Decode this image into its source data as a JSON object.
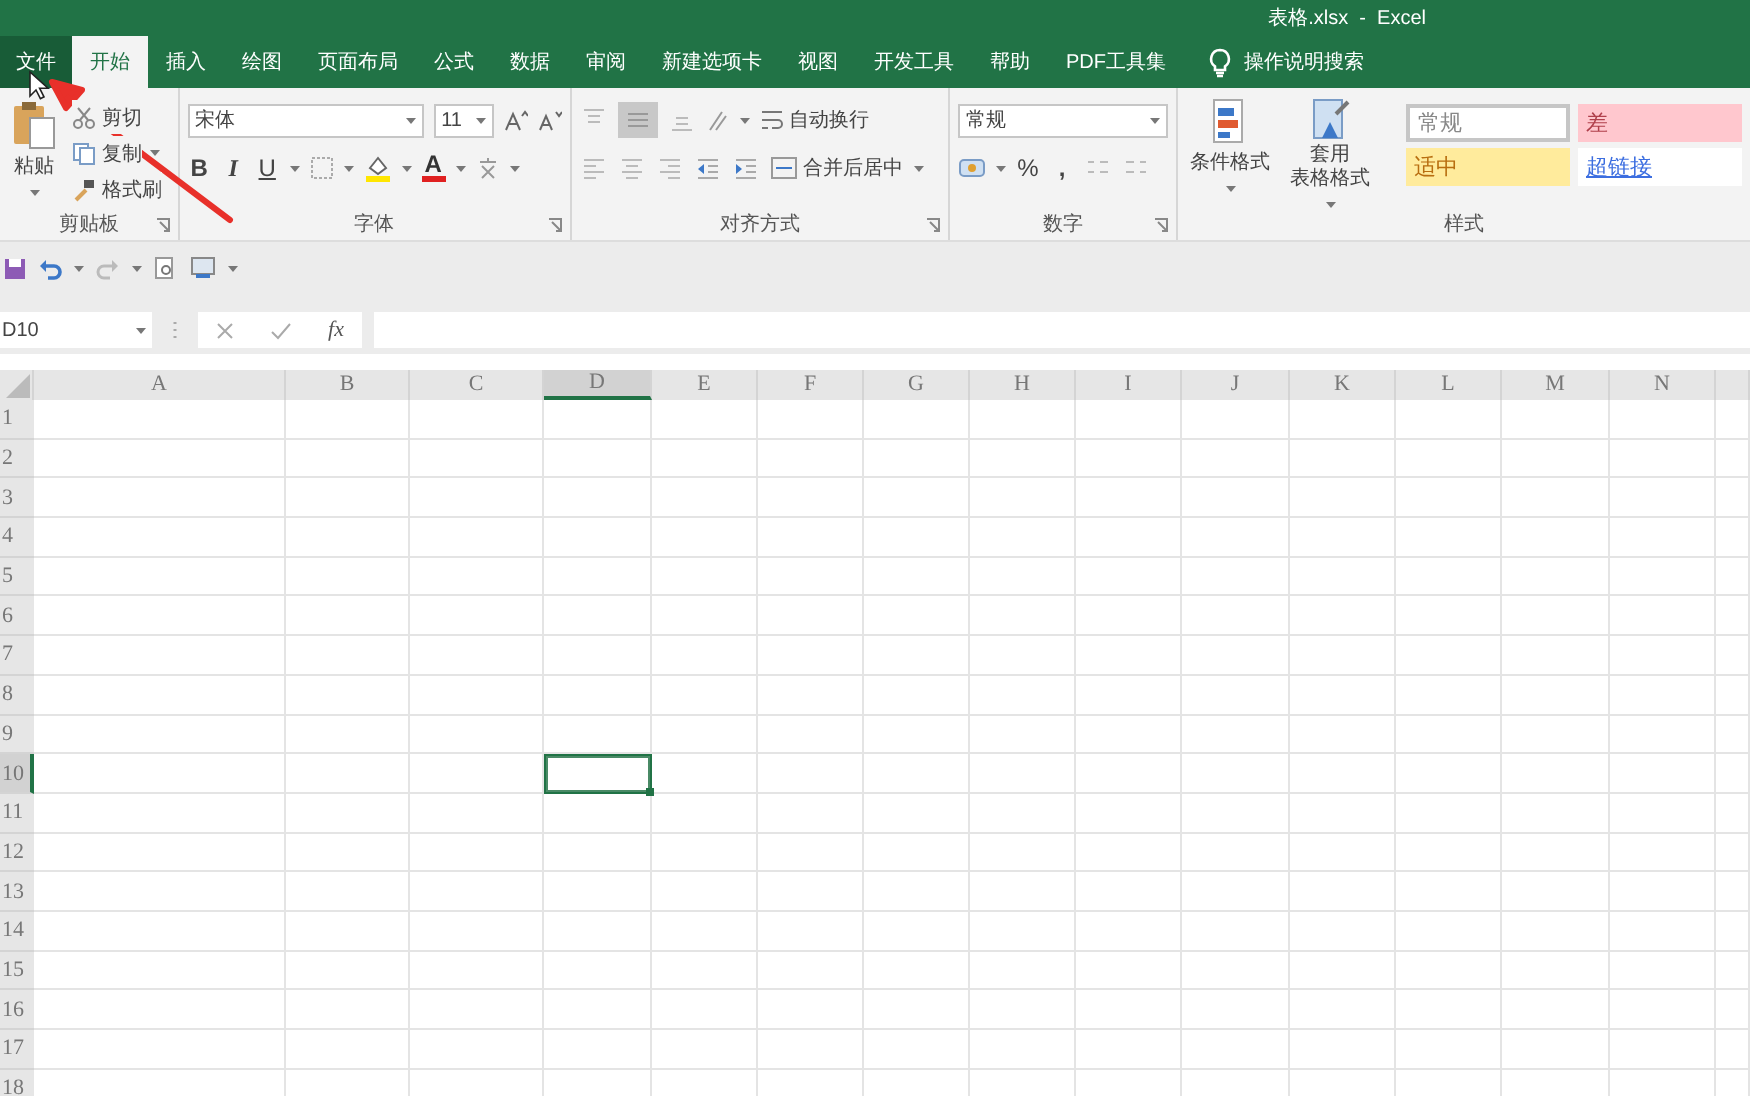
{
  "window": {
    "title": "表格.xlsx  -  Excel"
  },
  "tabs": [
    {
      "label": "文件",
      "kind": "file",
      "selected": false
    },
    {
      "label": "开始",
      "kind": "tab",
      "selected": true
    },
    {
      "label": "插入",
      "kind": "tab",
      "selected": false
    },
    {
      "label": "绘图",
      "kind": "tab",
      "selected": false
    },
    {
      "label": "页面布局",
      "kind": "tab",
      "selected": false
    },
    {
      "label": "公式",
      "kind": "tab",
      "selected": false
    },
    {
      "label": "数据",
      "kind": "tab",
      "selected": false
    },
    {
      "label": "审阅",
      "kind": "tab",
      "selected": false
    },
    {
      "label": "新建选项卡",
      "kind": "tab",
      "selected": false
    },
    {
      "label": "视图",
      "kind": "tab",
      "selected": false
    },
    {
      "label": "开发工具",
      "kind": "tab",
      "selected": false
    },
    {
      "label": "帮助",
      "kind": "tab",
      "selected": false
    },
    {
      "label": "PDF工具集",
      "kind": "tab",
      "selected": false
    }
  ],
  "tell_me": {
    "placeholder": "操作说明搜索"
  },
  "ribbon": {
    "clipboard": {
      "paste": "粘贴",
      "cut": "剪切",
      "copy": "复制",
      "format_painter": "格式刷",
      "label": "剪贴板"
    },
    "font": {
      "font_name": "宋体",
      "font_size": "11",
      "bold": "B",
      "italic": "I",
      "underline": "U",
      "font_color": "A",
      "label": "字体"
    },
    "alignment": {
      "wrap_text": "自动换行",
      "merge_center": "合并后居中",
      "label": "对齐方式"
    },
    "number": {
      "format": "常规",
      "percent": "%",
      "comma": ",",
      "label": "数字"
    },
    "styles": {
      "conditional_formatting": "条件格式",
      "format_as_table": [
        "套用",
        "表格格式"
      ],
      "label": "样式",
      "gallery": [
        {
          "label": "常规",
          "kind": "normal"
        },
        {
          "label": "差",
          "kind": "bad"
        },
        {
          "label": "适中",
          "kind": "neutral"
        },
        {
          "label": "超链接",
          "kind": "hyperlink"
        }
      ]
    }
  },
  "formula_bar": {
    "name_box": "D10",
    "fx": "fx"
  },
  "columns": [
    {
      "label": "A",
      "selected": false
    },
    {
      "label": "B",
      "selected": false
    },
    {
      "label": "C",
      "selected": false
    },
    {
      "label": "D",
      "selected": true
    },
    {
      "label": "E",
      "selected": false
    },
    {
      "label": "F",
      "selected": false
    },
    {
      "label": "G",
      "selected": false
    },
    {
      "label": "H",
      "selected": false
    },
    {
      "label": "I",
      "selected": false
    },
    {
      "label": "J",
      "selected": false
    },
    {
      "label": "K",
      "selected": false
    },
    {
      "label": "L",
      "selected": false
    },
    {
      "label": "M",
      "selected": false
    },
    {
      "label": "N",
      "selected": false
    }
  ],
  "rows": [
    {
      "label": "1",
      "selected": false
    },
    {
      "label": "2",
      "selected": false
    },
    {
      "label": "3",
      "selected": false
    },
    {
      "label": "4",
      "selected": false
    },
    {
      "label": "5",
      "selected": false
    },
    {
      "label": "6",
      "selected": false
    },
    {
      "label": "7",
      "selected": false
    },
    {
      "label": "8",
      "selected": false
    },
    {
      "label": "9",
      "selected": false
    },
    {
      "label": "10",
      "selected": true
    },
    {
      "label": "11",
      "selected": false
    },
    {
      "label": "12",
      "selected": false
    },
    {
      "label": "13",
      "selected": false
    },
    {
      "label": "14",
      "selected": false
    },
    {
      "label": "15",
      "selected": false
    },
    {
      "label": "16",
      "selected": false
    },
    {
      "label": "17",
      "selected": false
    },
    {
      "label": "18",
      "selected": false
    }
  ]
}
